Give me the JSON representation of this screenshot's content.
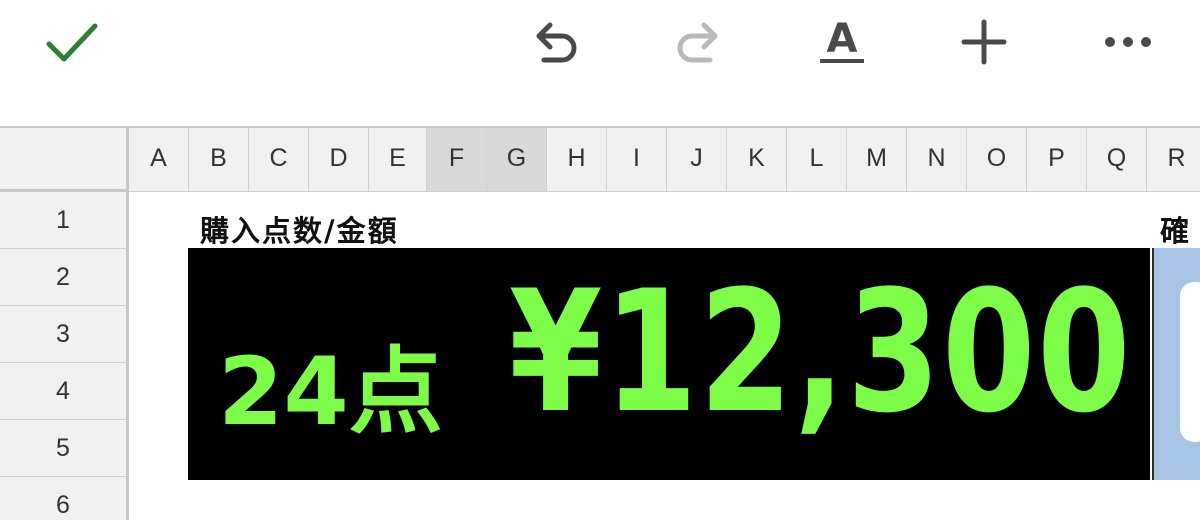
{
  "toolbar": {
    "confirm_icon": "checkmark-icon",
    "undo_icon": "undo-icon",
    "redo_icon": "redo-icon",
    "text_format_icon": "text-format-icon",
    "insert_icon": "plus-icon",
    "more_icon": "more-dots-icon",
    "text_format_label": "A",
    "confirm_color": "#2e7d32",
    "redo_disabled": true
  },
  "sheet": {
    "columns": [
      "A",
      "B",
      "C",
      "D",
      "E",
      "F",
      "G",
      "H",
      "I",
      "J",
      "K",
      "L",
      "M",
      "N",
      "O",
      "P",
      "Q",
      "R"
    ],
    "selected_columns": [
      "F",
      "G"
    ],
    "rows": [
      "1",
      "2",
      "3",
      "4",
      "5",
      "6"
    ],
    "cells": {
      "title": "購入点数/金額",
      "title_right": "確",
      "count": "24点",
      "amount": "¥12,300"
    },
    "colors": {
      "display_background": "#000000",
      "display_text": "#7dfd48",
      "side_panel": "#a7c4e4"
    }
  }
}
